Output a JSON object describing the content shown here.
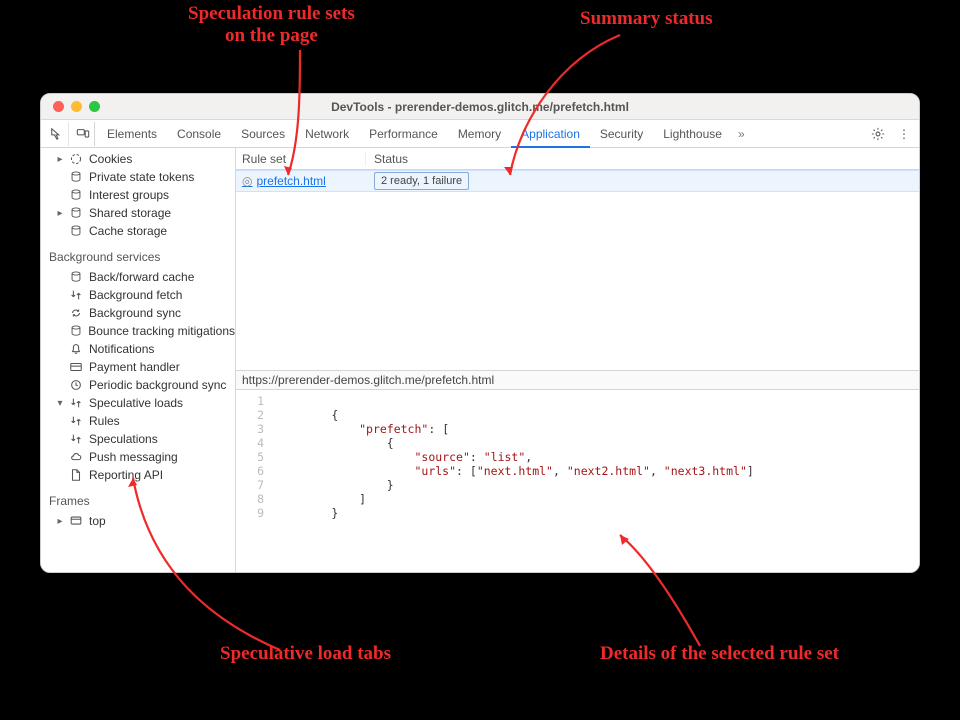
{
  "annotations": {
    "rule_sets": "Speculation rule sets\non the page",
    "summary_status": "Summary status",
    "load_tabs": "Speculative load tabs",
    "details": "Details of the selected rule set"
  },
  "window": {
    "title": "DevTools - prerender-demos.glitch.me/prefetch.html"
  },
  "tabs": {
    "items": [
      "Elements",
      "Console",
      "Sources",
      "Network",
      "Performance",
      "Memory",
      "Application",
      "Security",
      "Lighthouse"
    ],
    "active": "Application",
    "overflow": "»"
  },
  "sidebar": {
    "group1": {
      "cookies": "Cookies",
      "private_state": "Private state tokens",
      "interest_groups": "Interest groups",
      "shared_storage": "Shared storage",
      "cache_storage": "Cache storage"
    },
    "section_bg": "Background services",
    "bg": {
      "bf_cache": "Back/forward cache",
      "bg_fetch": "Background fetch",
      "bg_sync": "Background sync",
      "bounce": "Bounce tracking mitigations",
      "notifications": "Notifications",
      "payment": "Payment handler",
      "periodic": "Periodic background sync",
      "spec_loads": "Speculative loads",
      "rules": "Rules",
      "speculations": "Speculations",
      "push": "Push messaging",
      "reporting": "Reporting API"
    },
    "section_frames": "Frames",
    "frames": {
      "top": "top"
    }
  },
  "table": {
    "col_ruleset": "Rule set",
    "col_status": "Status",
    "rows": [
      {
        "ruleset": " prefetch.html",
        "status": "2 ready, 1 failure"
      }
    ]
  },
  "url": "https://prerender-demos.glitch.me/prefetch.html",
  "json_source": {
    "prefetch": [
      {
        "source": "list",
        "urls": [
          "next.html",
          "next2.html",
          "next3.html"
        ]
      }
    ]
  }
}
